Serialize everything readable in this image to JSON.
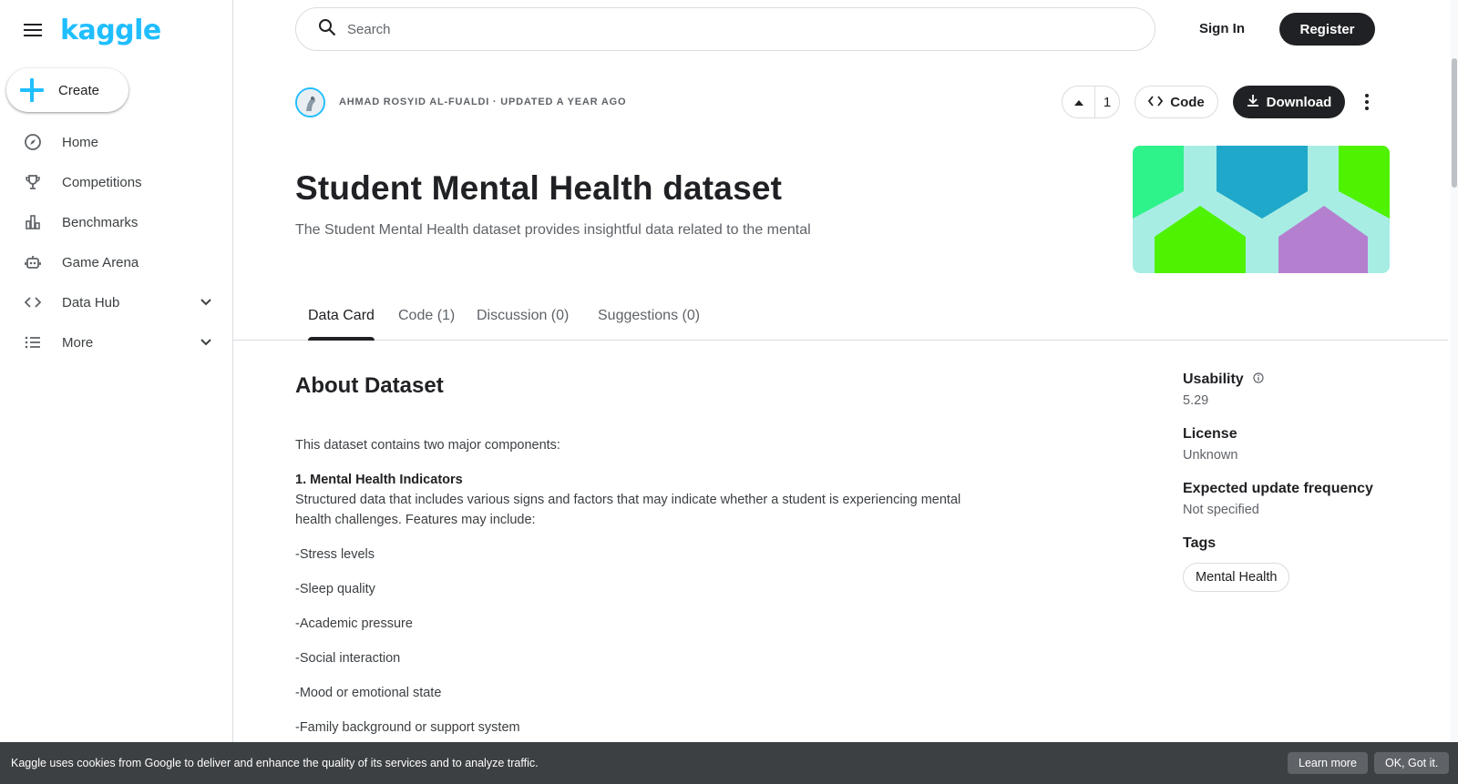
{
  "app": {
    "logo_text": "kaggle",
    "brand_color": "#20beff"
  },
  "sidebar": {
    "create_label": "Create",
    "items": [
      {
        "label": "Home",
        "icon": "compass-icon"
      },
      {
        "label": "Competitions",
        "icon": "trophy-icon"
      },
      {
        "label": "Benchmarks",
        "icon": "bar-chart-icon"
      },
      {
        "label": "Game Arena",
        "icon": "robot-icon"
      },
      {
        "label": "Data Hub",
        "icon": "code-icon",
        "expandable": true
      },
      {
        "label": "More",
        "icon": "list-icon",
        "expandable": true
      }
    ]
  },
  "header": {
    "search_placeholder": "Search",
    "signin_label": "Sign In",
    "register_label": "Register"
  },
  "dataset": {
    "meta": "AHMAD ROSYID AL-FUALDI · UPDATED A YEAR AGO",
    "upvotes": "1",
    "code_label": "Code",
    "download_label": "Download",
    "title": "Student Mental Health dataset",
    "subtitle": "The Student Mental Health dataset provides insightful data related to the mental",
    "cover_colors": [
      "#2ef28a",
      "#1fa8c9",
      "#4ff200",
      "#b57fcf",
      "#a8ede4"
    ]
  },
  "tabs": [
    {
      "label": "Data Card",
      "active": true
    },
    {
      "label": "Code (1)",
      "active": false
    },
    {
      "label": "Discussion (0)",
      "active": false
    },
    {
      "label": "Suggestions (0)",
      "active": false
    }
  ],
  "about": {
    "heading": "About Dataset",
    "intro": "This dataset contains two major components:",
    "section1_title": "1. Mental Health Indicators",
    "section1_body": "Structured data that includes various signs and factors that may indicate whether a student is experiencing mental health challenges. Features may include:",
    "features": [
      "-Stress levels",
      "-Sleep quality",
      "-Academic pressure",
      "-Social interaction",
      "-Mood or emotional state",
      "-Family background or support system"
    ]
  },
  "panel": {
    "usability_label": "Usability",
    "usability_value": "5.29",
    "license_label": "License",
    "license_value": "Unknown",
    "frequency_label": "Expected update frequency",
    "frequency_value": "Not specified",
    "tags_label": "Tags",
    "tags": [
      "Mental Health"
    ]
  },
  "cookie": {
    "text": "Kaggle uses cookies from Google to deliver and enhance the quality of its services and to analyze traffic.",
    "learn_more": "Learn more",
    "ok": "OK, Got it."
  }
}
